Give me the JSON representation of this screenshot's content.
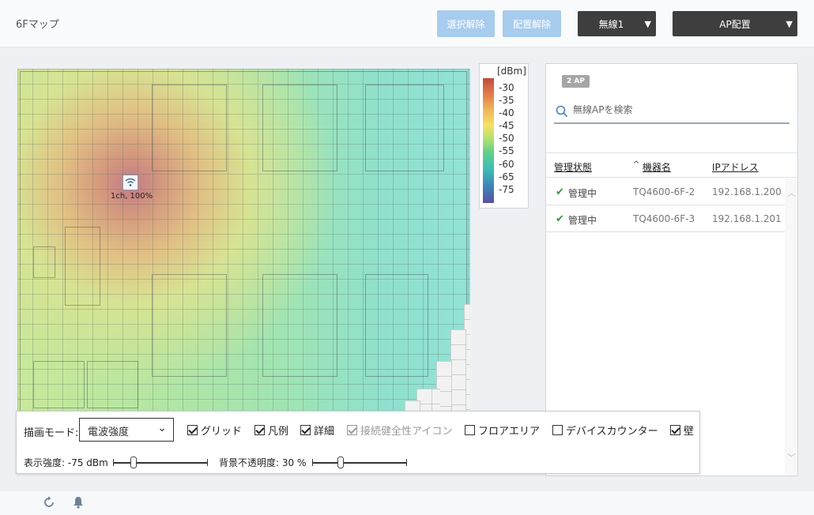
{
  "header": {
    "title": "6Fマップ",
    "deselect_label": "選択解除",
    "unplace_label": "配置解除",
    "radio_select": "無線1",
    "ap_place_label": "AP配置"
  },
  "map": {
    "ap_label": "1ch, 100%"
  },
  "legend": {
    "unit": "[dBm]",
    "ticks": [
      "-30",
      "-35",
      "-40",
      "-45",
      "-50",
      "-55",
      "-60",
      "-65",
      "-75"
    ]
  },
  "panel": {
    "badge": "2 AP",
    "search_placeholder": "無線APを検索",
    "columns": {
      "status": "管理状態",
      "name": "機器名",
      "ip": "IPアドレス"
    },
    "rows": [
      {
        "status": "管理中",
        "name": "TQ4600-6F-2",
        "ip": "192.168.1.200"
      },
      {
        "status": "管理中",
        "name": "TQ4600-6F-3",
        "ip": "192.168.1.201"
      }
    ]
  },
  "controls": {
    "mode_label": "描画モード:",
    "mode_value": "電波強度",
    "checkboxes": [
      {
        "label": "グリッド",
        "checked": true
      },
      {
        "label": "凡例",
        "checked": true
      },
      {
        "label": "詳細",
        "checked": true
      },
      {
        "label": "接続健全性アイコン",
        "checked": true,
        "disabled": true
      },
      {
        "label": "フロアエリア",
        "checked": false
      },
      {
        "label": "デバイスカウンター",
        "checked": false
      },
      {
        "label": "壁",
        "checked": true
      }
    ],
    "strength_label": "表示強度: -75 dBm",
    "opacity_label": "背景不透明度: 30 %"
  },
  "colors": {
    "accent_button": "#a7ccee",
    "dark_button": "#3e3e3e",
    "check_green": "#2e9a3e"
  }
}
